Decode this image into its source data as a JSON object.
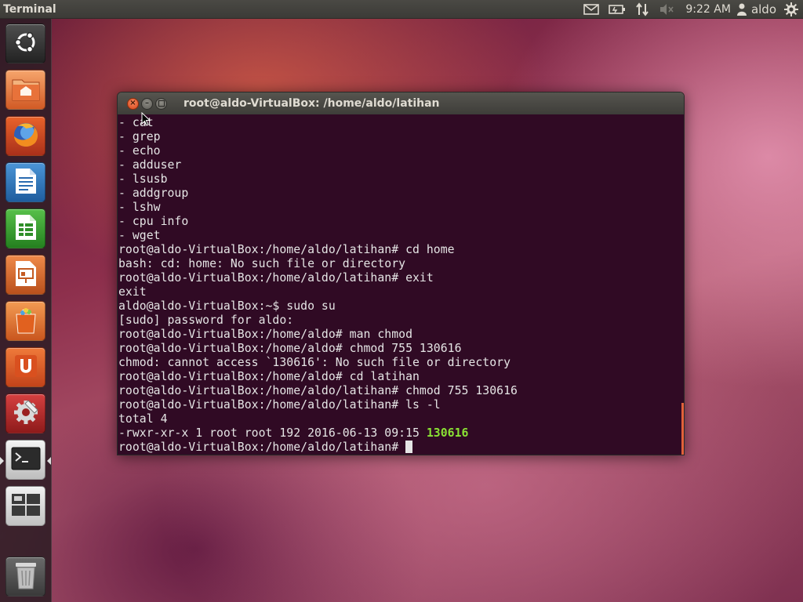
{
  "top_panel": {
    "app_title": "Terminal",
    "clock": "9:22 AM",
    "user": "aldo",
    "indicators": [
      "mail-icon",
      "battery-icon",
      "network-icon",
      "volume-muted-icon",
      "user-icon",
      "gear-icon"
    ]
  },
  "launcher": {
    "items": [
      {
        "name": "dash-home",
        "icon": "ubuntu-logo-icon"
      },
      {
        "name": "home-folder",
        "icon": "home-folder-icon"
      },
      {
        "name": "firefox",
        "icon": "firefox-icon"
      },
      {
        "name": "libreoffice-writer",
        "icon": "writer-icon"
      },
      {
        "name": "libreoffice-calc",
        "icon": "calc-icon"
      },
      {
        "name": "libreoffice-impress",
        "icon": "impress-icon"
      },
      {
        "name": "ubuntu-software-center",
        "icon": "software-center-icon"
      },
      {
        "name": "ubuntu-one",
        "icon": "ubuntu-one-icon"
      },
      {
        "name": "system-settings",
        "icon": "settings-icon"
      },
      {
        "name": "terminal",
        "icon": "terminal-icon"
      },
      {
        "name": "workspace-switcher",
        "icon": "workspaces-icon"
      },
      {
        "name": "trash",
        "icon": "trash-icon"
      }
    ]
  },
  "terminal": {
    "title": "root@aldo-VirtualBox: /home/aldo/latihan",
    "lines": [
      "- cat",
      "- grep",
      "- echo",
      "- adduser",
      "- lsusb",
      "- addgroup",
      "- lshw",
      "- cpu info",
      "- wget",
      "root@aldo-VirtualBox:/home/aldo/latihan# cd home",
      "bash: cd: home: No such file or directory",
      "root@aldo-VirtualBox:/home/aldo/latihan# exit",
      "exit",
      "aldo@aldo-VirtualBox:~$ sudo su",
      "[sudo] password for aldo:",
      "root@aldo-VirtualBox:/home/aldo# man chmod",
      "root@aldo-VirtualBox:/home/aldo# chmod 755 130616",
      "chmod: cannot access `130616': No such file or directory",
      "root@aldo-VirtualBox:/home/aldo# cd latihan",
      "root@aldo-VirtualBox:/home/aldo/latihan# chmod 755 130616",
      "root@aldo-VirtualBox:/home/aldo/latihan# ls -l",
      "total 4"
    ],
    "ls_line_prefix": "-rwxr-xr-x 1 root root 192 2016-06-13 09:15 ",
    "ls_line_file": "130616",
    "prompt": "root@aldo-VirtualBox:/home/aldo/latihan# "
  },
  "colors": {
    "terminal_bg": "#300a24",
    "terminal_fg": "#e5e5e5",
    "executable_green": "#8ae234",
    "close_button": "#e0521f"
  }
}
